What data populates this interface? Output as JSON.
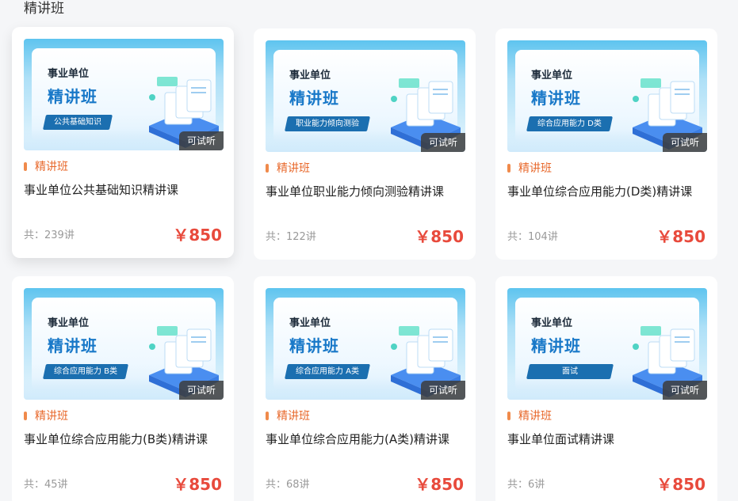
{
  "section": {
    "title": "精讲班"
  },
  "brand": {
    "accent": "#e8692c",
    "price_color": "#e84a3c",
    "banner_blue": "#1878c8",
    "tag_bg": "#1b6fb0"
  },
  "cards": [
    {
      "banner_kicker": "事业单位",
      "banner_title": "精讲班",
      "banner_tag": "公共基础知识",
      "trial_label": "可试听",
      "category": "精讲班",
      "name": "事业单位公共基础知识精讲课",
      "lessons": "共：239讲",
      "price": "￥850"
    },
    {
      "banner_kicker": "事业单位",
      "banner_title": "精讲班",
      "banner_tag": "职业能力倾向测验",
      "trial_label": "可试听",
      "category": "精讲班",
      "name": "事业单位职业能力倾向测验精讲课",
      "lessons": "共：122讲",
      "price": "￥850"
    },
    {
      "banner_kicker": "事业单位",
      "banner_title": "精讲班",
      "banner_tag": "综合应用能力 D类",
      "trial_label": "可试听",
      "category": "精讲班",
      "name": "事业单位综合应用能力(D类)精讲课",
      "lessons": "共：104讲",
      "price": "￥850"
    },
    {
      "banner_kicker": "事业单位",
      "banner_title": "精讲班",
      "banner_tag": "综合应用能力 B类",
      "trial_label": "可试听",
      "category": "精讲班",
      "name": "事业单位综合应用能力(B类)精讲课",
      "lessons": "共：45讲",
      "price": "￥850"
    },
    {
      "banner_kicker": "事业单位",
      "banner_title": "精讲班",
      "banner_tag": "综合应用能力 A类",
      "trial_label": "可试听",
      "category": "精讲班",
      "name": "事业单位综合应用能力(A类)精讲课",
      "lessons": "共：68讲",
      "price": "￥850"
    },
    {
      "banner_kicker": "事业单位",
      "banner_title": "精讲班",
      "banner_tag": "面试",
      "trial_label": "可试听",
      "category": "精讲班",
      "name": "事业单位面试精讲课",
      "lessons": "共：6讲",
      "price": "￥850"
    }
  ]
}
